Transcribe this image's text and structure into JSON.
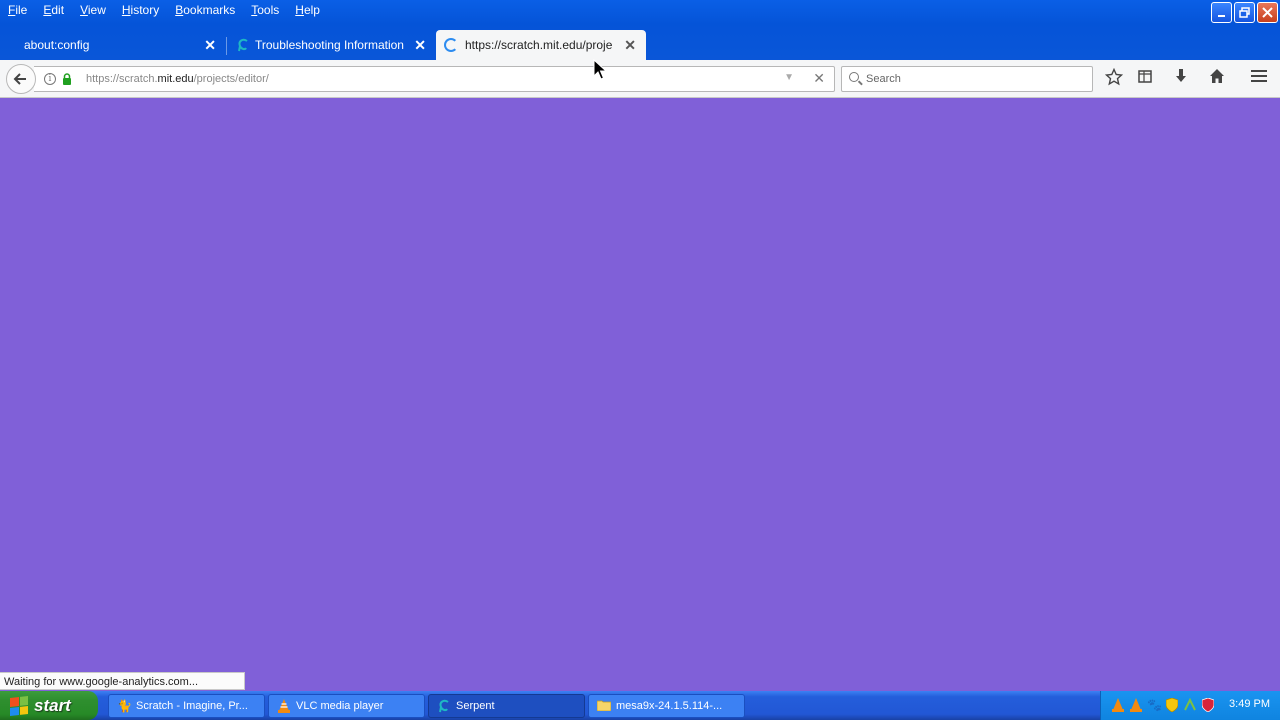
{
  "menu": [
    "File",
    "Edit",
    "View",
    "History",
    "Bookmarks",
    "Tools",
    "Help"
  ],
  "tabs": [
    {
      "title": "about:config",
      "close": "✕"
    },
    {
      "title": "Troubleshooting Information",
      "close": "✕"
    },
    {
      "title": "https://scratch.mit.edu/projects/editor/",
      "close": "✕"
    }
  ],
  "new_tab": "+",
  "url": {
    "prefix": "https://scratch.",
    "host": "mit.edu",
    "path": "/projects/editor/"
  },
  "search": {
    "placeholder": "Search"
  },
  "status": "Waiting for www.google-analytics.com...",
  "taskbar": {
    "start": "start",
    "tasks": [
      "Scratch - Imagine, Pr...",
      "VLC media player",
      "Serpent",
      "mesa9x-24.1.5.114-..."
    ],
    "clock": "3:49 PM"
  },
  "colors": {
    "page_background": "#8060d8",
    "titlebar": "#0554d8",
    "taskbar": "#245edb",
    "start_button": "#2f8f2f"
  }
}
